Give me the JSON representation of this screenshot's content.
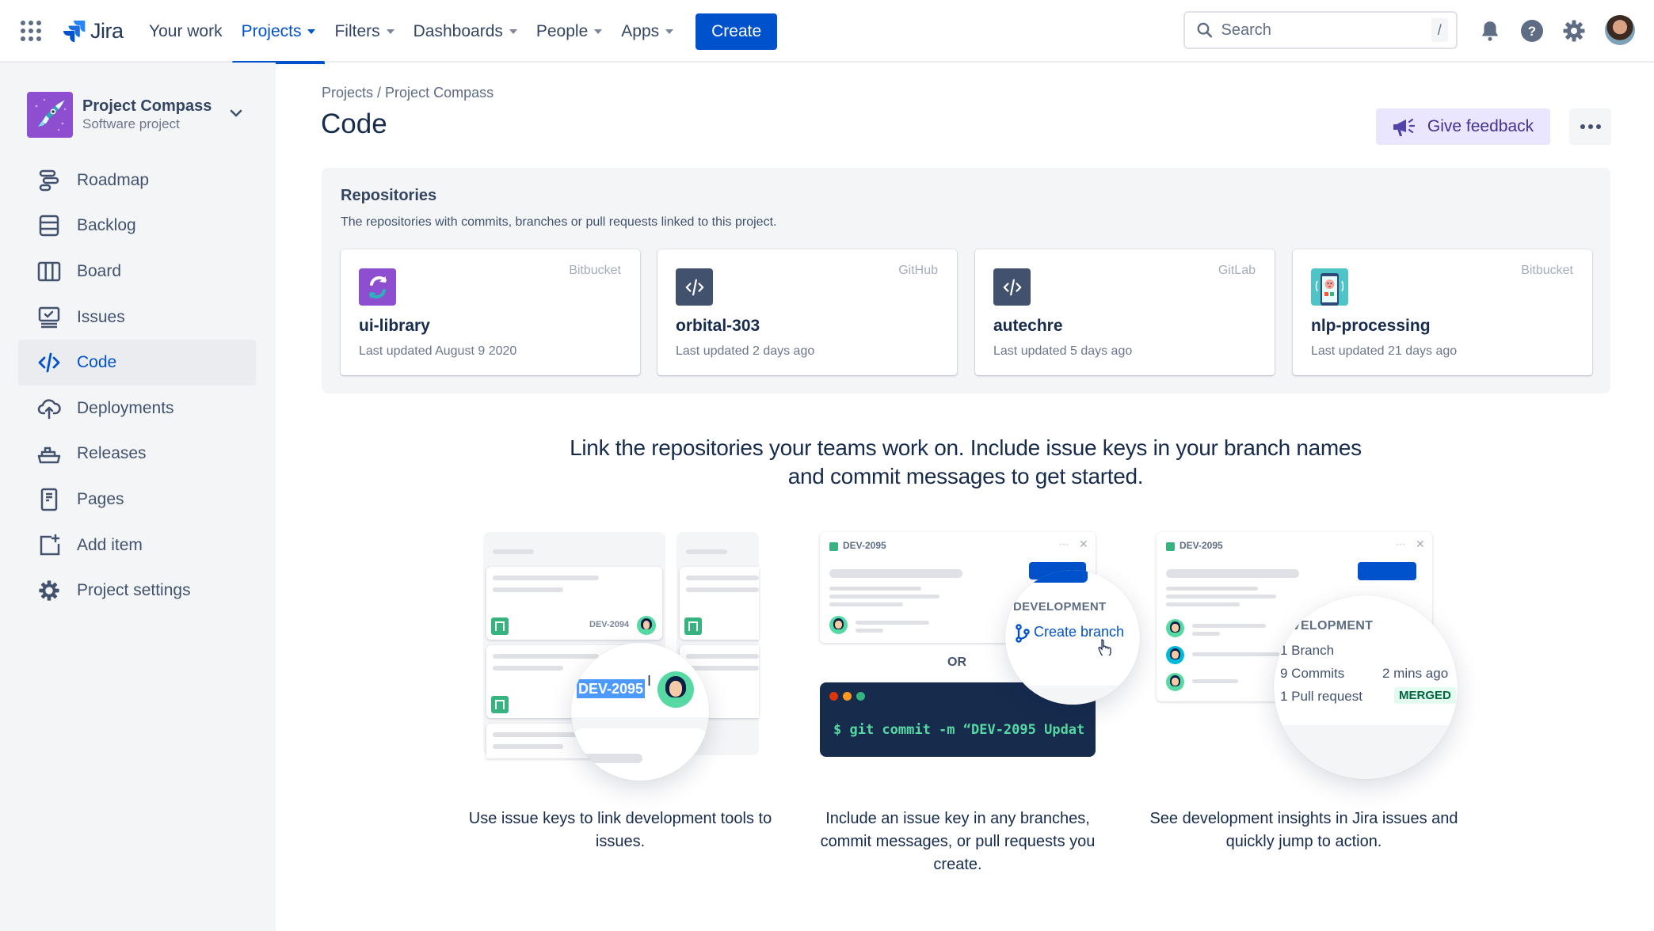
{
  "topbar": {
    "app_name": "Jira",
    "nav": [
      {
        "label": "Your work",
        "has_caret": false,
        "active": false
      },
      {
        "label": "Projects",
        "has_caret": true,
        "active": true
      },
      {
        "label": "Filters",
        "has_caret": true,
        "active": false
      },
      {
        "label": "Dashboards",
        "has_caret": true,
        "active": false
      },
      {
        "label": "People",
        "has_caret": true,
        "active": false
      },
      {
        "label": "Apps",
        "has_caret": true,
        "active": false
      }
    ],
    "create_label": "Create",
    "search_placeholder": "Search",
    "search_shortcut": "/",
    "icons": [
      "app-switcher-icon",
      "notifications-icon",
      "help-icon",
      "settings-icon",
      "profile-avatar"
    ]
  },
  "sidebar": {
    "project_name": "Project Compass",
    "project_type": "Software project",
    "items": [
      {
        "label": "Roadmap",
        "icon": "roadmap-icon",
        "active": false
      },
      {
        "label": "Backlog",
        "icon": "backlog-icon",
        "active": false
      },
      {
        "label": "Board",
        "icon": "board-icon",
        "active": false
      },
      {
        "label": "Issues",
        "icon": "issues-icon",
        "active": false
      },
      {
        "label": "Code",
        "icon": "code-icon",
        "active": true
      },
      {
        "label": "Deployments",
        "icon": "deployments-icon",
        "active": false
      },
      {
        "label": "Releases",
        "icon": "releases-icon",
        "active": false
      },
      {
        "label": "Pages",
        "icon": "pages-icon",
        "active": false
      },
      {
        "label": "Add item",
        "icon": "add-item-icon",
        "active": false
      },
      {
        "label": "Project settings",
        "icon": "project-settings-icon",
        "active": false
      }
    ]
  },
  "main": {
    "breadcrumb": {
      "root": "Projects",
      "separator": " / ",
      "current": "Project Compass"
    },
    "title": "Code",
    "feedback_label": "Give feedback",
    "repositories": {
      "title": "Repositories",
      "description": "The repositories with commits, branches or pull requests linked to this project.",
      "items": [
        {
          "name": "ui-library",
          "host": "Bitbucket",
          "updated": "Last updated August 9 2020",
          "icon": "sync-repo-icon"
        },
        {
          "name": "orbital-303",
          "host": "GitHub",
          "updated": "Last updated 2 days ago",
          "icon": "code-repo-icon"
        },
        {
          "name": "autechre",
          "host": "GitLab",
          "updated": "Last updated 5 days ago",
          "icon": "code-repo-icon"
        },
        {
          "name": "nlp-processing",
          "host": "Bitbucket",
          "updated": "Last updated 21 days ago",
          "icon": "phone-repo-icon"
        }
      ]
    },
    "headline": "Link the repositories your teams work on. Include issue keys in your branch names and commit messages to get started.",
    "steps": [
      {
        "caption": "Use issue keys to link development tools to issues.",
        "illustration": {
          "issue_key_small": "DEV-2094",
          "issue_key_selected": "DEV-2095"
        }
      },
      {
        "caption": "Include an issue key in any branches, commit messages, or pull requests you create.",
        "illustration": {
          "issue_key": "DEV-2095",
          "section_label": "DEVELOPMENT",
          "action_label": "Create branch",
          "or_label": "OR",
          "terminal_command": "$ git commit -m “DEV-2095 Updat"
        }
      },
      {
        "caption": "See development insights in Jira issues and quickly jump to action.",
        "illustration": {
          "issue_key": "DEV-2095",
          "section_label": "EVELOPMENT",
          "branch_count": "1 Branch",
          "commit_count": "9 Commits",
          "commit_time": "2 mins ago",
          "pr_count": "1 Pull request",
          "pr_status": "MERGED"
        }
      }
    ]
  },
  "colors": {
    "brand_blue": "#0052CC",
    "sidebar_bg": "#F4F5F7",
    "feedback_bg": "#EAE6FF",
    "feedback_text": "#403294",
    "merged_bg": "#E3FCEF",
    "merged_text": "#006644",
    "terminal_bg": "#172B4D",
    "terminal_text": "#57D9A3"
  }
}
